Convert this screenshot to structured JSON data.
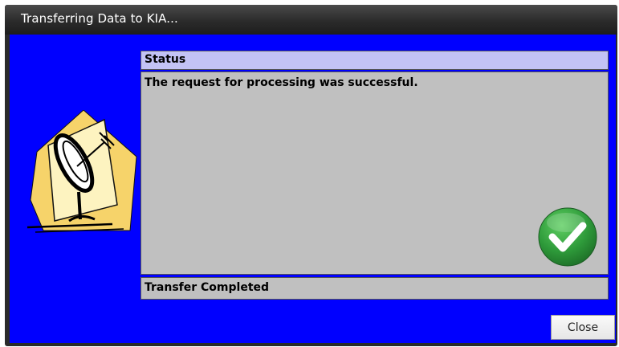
{
  "window": {
    "title": "Transferring Data to KIA..."
  },
  "status": {
    "header": "Status",
    "message": "The request for processing was successful.",
    "footer": "Transfer Completed"
  },
  "actions": {
    "close_label": "Close"
  },
  "icons": {
    "left": "satellite-dish-icon",
    "result": "checkmark-success-icon"
  },
  "colors": {
    "body_bg": "#0000ff",
    "header_bg": "#c3c3f5",
    "panel_bg": "#c0c0c0",
    "success_green": "#2e9a3a"
  }
}
